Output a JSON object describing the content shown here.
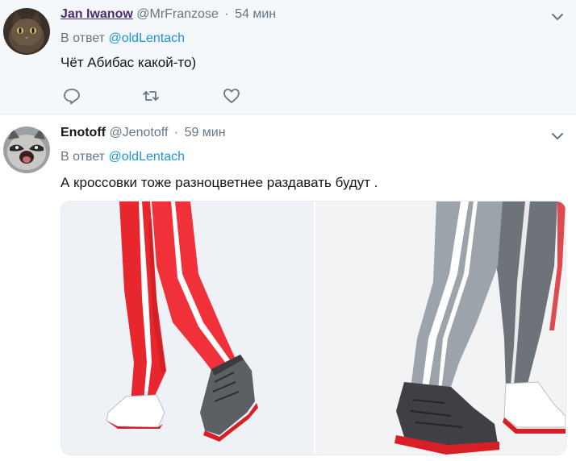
{
  "tweets": [
    {
      "name": "Jan Iwanow",
      "handle": "@MrFranzose",
      "separator": "·",
      "time": "54 мин",
      "reply_prefix": "В ответ",
      "reply_to": "@oldLentach",
      "text": "Чёт Абибас какой-то)",
      "avatar_icon": "cat-avatar",
      "actions": [
        "reply-icon",
        "retweet-icon",
        "like-icon"
      ]
    },
    {
      "name": "Enotoff",
      "handle": "@Jenotoff",
      "separator": "·",
      "time": "59 мин",
      "reply_prefix": "В ответ",
      "reply_to": "@oldLentach",
      "text": "А кроссовки тоже разноцветнее раздавать будут .",
      "avatar_icon": "raccoon-avatar",
      "media": [
        "red-tracksuit-legs-photo",
        "grey-tracksuit-legs-photo"
      ]
    }
  ],
  "colors": {
    "link": "#1b95e0",
    "muted": "#657786",
    "highlight_bg": "#f5f8fa",
    "visited_name": "#4b2c6f"
  }
}
